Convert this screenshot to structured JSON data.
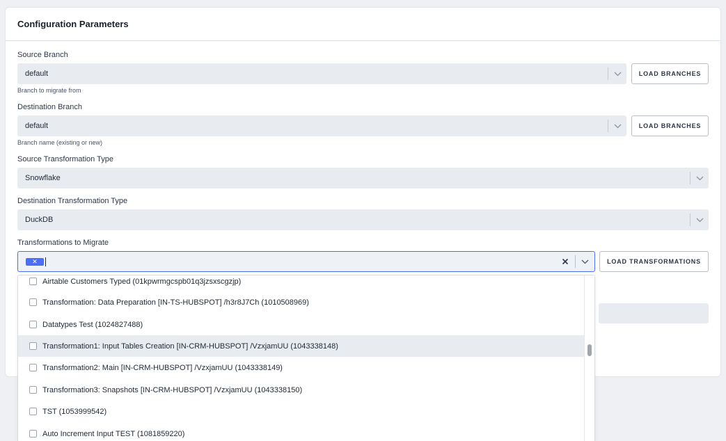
{
  "card": {
    "title": "Configuration Parameters"
  },
  "source_branch": {
    "label": "Source Branch",
    "value": "default",
    "hint": "Branch to migrate from",
    "button": "LOAD BRANCHES"
  },
  "destination_branch": {
    "label": "Destination Branch",
    "value": "default",
    "hint": "Branch name (existing or new)",
    "button": "LOAD BRANCHES"
  },
  "source_transformation_type": {
    "label": "Source Transformation Type",
    "value": "Snowflake"
  },
  "destination_transformation_type": {
    "label": "Destination Transformation Type",
    "value": "DuckDB"
  },
  "transformations": {
    "label": "Transformations to Migrate",
    "chip_remove": "✕",
    "button": "LOAD TRANSFORMATIONS",
    "options": [
      {
        "label": "Airtable Customers Typed (01kpwrmgcspb01q3jzsxscgzjp)",
        "highlighted": false
      },
      {
        "label": "Transformation: Data Preparation [IN-TS-HUBSPOT] /h3r8J7Ch (1010508969)",
        "highlighted": false
      },
      {
        "label": "Datatypes Test (1024827488)",
        "highlighted": false
      },
      {
        "label": "Transformation1: Input Tables Creation [IN-CRM-HUBSPOT] /VzxjamUU (1043338148)",
        "highlighted": true
      },
      {
        "label": "Transformation2: Main [IN-CRM-HUBSPOT] /VzxjamUU (1043338149)",
        "highlighted": false
      },
      {
        "label": "Transformation3: Snapshots [IN-CRM-HUBSPOT] /VzxjamUU (1043338150)",
        "highlighted": false
      },
      {
        "label": "TST (1053999542)",
        "highlighted": false
      },
      {
        "label": "Auto Increment Input TEST (1081859220)",
        "highlighted": false
      }
    ]
  },
  "colors": {
    "accent": "#4c6ef5",
    "field_bg": "#e8ebf0",
    "highlight": "#e8ebf0"
  },
  "icons": [
    "chevron-down-icon",
    "close-icon",
    "checkbox-icon"
  ]
}
